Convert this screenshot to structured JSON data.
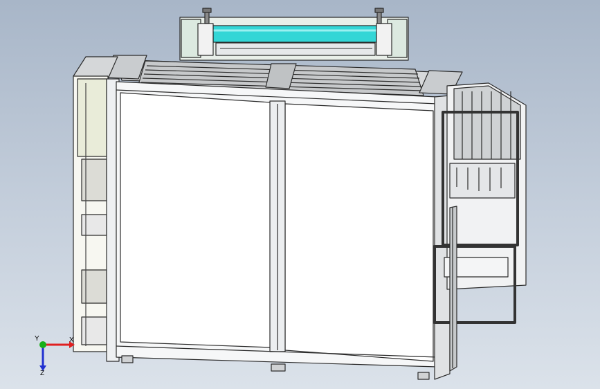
{
  "viewport": {
    "background_top": "#a8b6c8",
    "background_bottom": "#dbe2ea"
  },
  "model": {
    "frame_color": "#f4f6f8",
    "edge_color": "#2b2b2b",
    "roller_color": "#33d6d6",
    "side_panel_color": "#e9ecd9",
    "shade_color": "#b9bcbf"
  },
  "triad": {
    "x_label": "X",
    "y_label": "Y",
    "z_label": "Z",
    "x_color": "#e02020",
    "y_color": "#18b018",
    "z_color": "#2030d0"
  }
}
